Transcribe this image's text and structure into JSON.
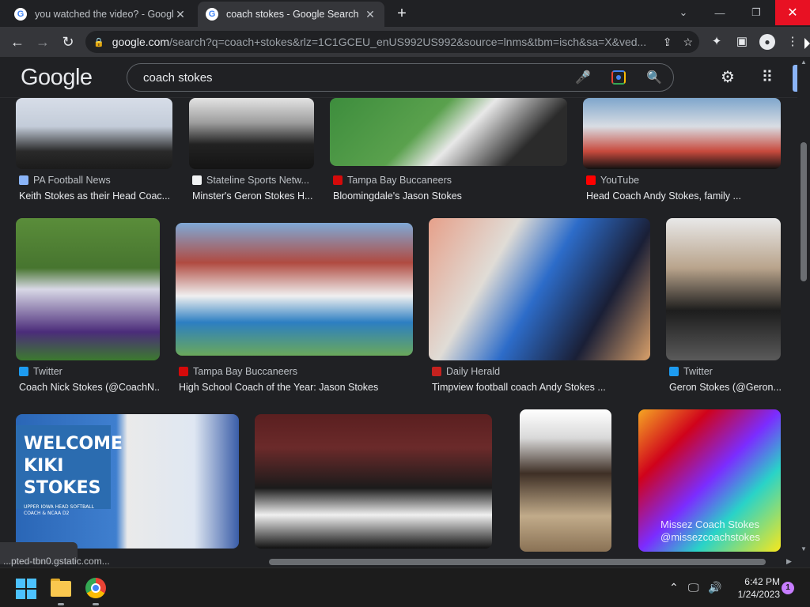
{
  "tabs": [
    {
      "title": "you watched the video? - Google",
      "favicon": "G",
      "active": false
    },
    {
      "title": "coach stokes - Google Search",
      "favicon": "G",
      "active": true
    }
  ],
  "window_controls": {
    "new_tab": "+",
    "dropdown": "⌄",
    "minimize": "—",
    "maximize": "❐",
    "close": "✕"
  },
  "address_bar": {
    "domain": "google.com",
    "path": "/search?q=coach+stokes&rlz=1C1GCEU_enUS992US992&source=lnms&tbm=isch&sa=X&ved...",
    "icons": [
      "share-icon",
      "bookmark-star-icon"
    ]
  },
  "toolbar_icons": [
    "extensions-icon",
    "side-panel-icon",
    "profile-icon",
    "menu-icon"
  ],
  "google_header": {
    "logo": "Google",
    "query": "coach stokes"
  },
  "results": [
    {
      "source": "PA Football News",
      "caption": "Keith Stokes as their Head Coac...",
      "fav": "pa"
    },
    {
      "source": "Stateline Sports Netw...",
      "caption": "Minster's Geron Stokes H...",
      "fav": "st"
    },
    {
      "source": "Tampa Bay Buccaneers",
      "caption": "Bloomingdale's Jason Stokes",
      "fav": "tb"
    },
    {
      "source": "YouTube",
      "caption": "Head Coach Andy Stokes, family ...",
      "fav": "yt"
    },
    {
      "source": "Twitter",
      "caption": "Coach Nick Stokes (@CoachN...",
      "fav": "tw"
    },
    {
      "source": "Tampa Bay Buccaneers",
      "caption": "High School Coach of the Year: Jason Stokes",
      "fav": "tb"
    },
    {
      "source": "Daily Herald",
      "caption": "Timpview football coach Andy Stokes ...",
      "fav": "dh"
    },
    {
      "source": "Twitter",
      "caption": "Geron Stokes (@Geron...",
      "fav": "tw"
    }
  ],
  "image_text": {
    "welcome": [
      "WELCOME",
      "KIKI STOKES"
    ],
    "welcome_sub": "UPPER IOWA HEAD SOFTBALL COACH & NCAA D2",
    "watermark": [
      "Missez Coach Stokes",
      "@missezcoachstokes"
    ]
  },
  "status_bar": {
    "url": "...pted-tbn0.gstatic.com..."
  },
  "taskbar": {
    "apps": [
      "windows-start-icon",
      "file-explorer-icon",
      "chrome-icon"
    ],
    "time": "6:42 PM",
    "date": "1/24/2023",
    "notifications": "1"
  }
}
